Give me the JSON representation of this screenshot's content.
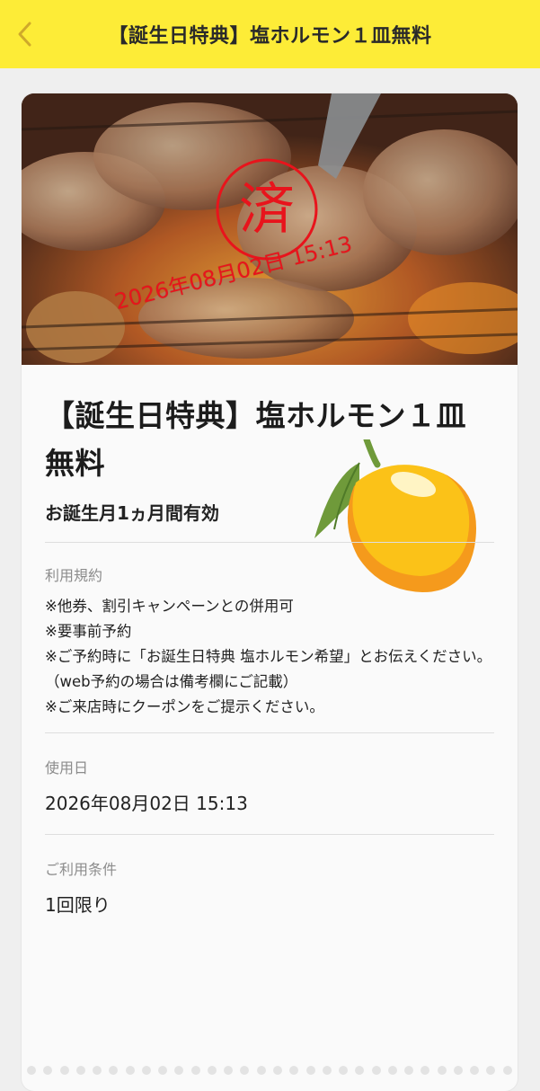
{
  "header": {
    "title": "【誕生日特典】塩ホルモン１皿無料",
    "back_icon": "chevron-left-icon",
    "background": "#fdec37"
  },
  "coupon": {
    "stamp_char": "済",
    "used_stamp_text": "2026年08月02日 15:13",
    "title": "【誕生日特典】塩ホルモン１皿無料",
    "validity": "お誕生月1ヵ月間有効",
    "sticker_icon": "lemon-icon"
  },
  "terms": {
    "label": "利用規約",
    "lines": [
      "※他券、割引キャンペーンとの併用可",
      "※要事前予約",
      "※ご予約時に「お誕生日特典 塩ホルモン希望」とお伝えください。（web予約の場合は備考欄にご記載）",
      "※ご来店時にクーポンをご提示ください。"
    ]
  },
  "usage_date": {
    "label": "使用日",
    "value": "2026年08月02日 15:13"
  },
  "conditions": {
    "label": "ご利用条件",
    "value": "1回限り"
  },
  "colors": {
    "accent_yellow": "#fdec37",
    "stamp_red": "#e8141c"
  }
}
